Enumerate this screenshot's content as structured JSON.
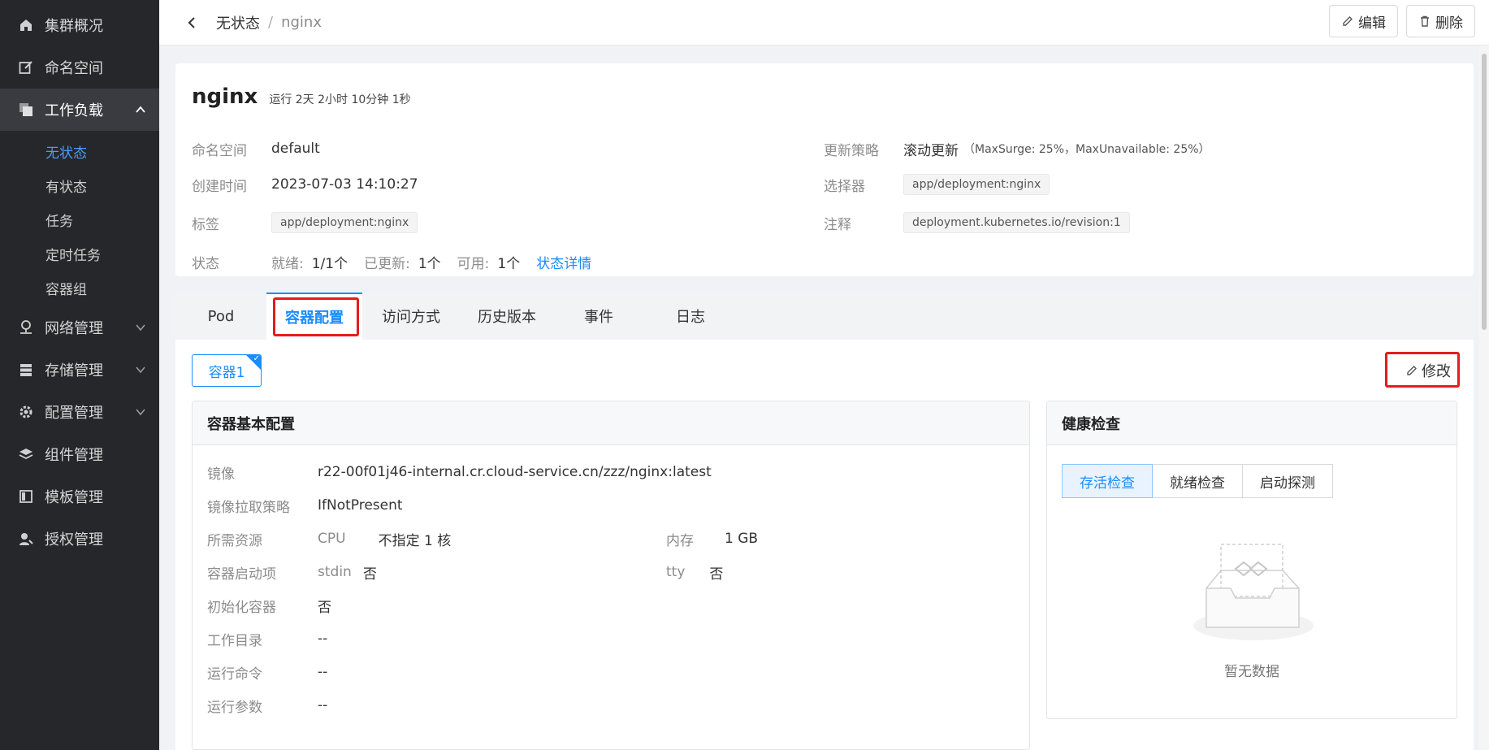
{
  "sidebar": {
    "items": [
      {
        "label": "集群概况",
        "icon": "home-icon"
      },
      {
        "label": "命名空间",
        "icon": "edit-square-icon"
      },
      {
        "label": "工作负载",
        "icon": "copy-icon",
        "expanded": true
      },
      {
        "label": "网络管理",
        "icon": "network-icon"
      },
      {
        "label": "存储管理",
        "icon": "database-icon"
      },
      {
        "label": "配置管理",
        "icon": "gear-icon"
      },
      {
        "label": "组件管理",
        "icon": "layers-icon"
      },
      {
        "label": "模板管理",
        "icon": "layout-icon"
      },
      {
        "label": "授权管理",
        "icon": "user-key-icon"
      }
    ],
    "workload_children": [
      "无状态",
      "有状态",
      "任务",
      "定时任务",
      "容器组"
    ],
    "active_child": "无状态"
  },
  "breadcrumb": {
    "parent": "无状态",
    "separator": "/",
    "current": "nginx"
  },
  "top_actions": {
    "edit": "编辑",
    "delete": "删除"
  },
  "deployment": {
    "name": "nginx",
    "runtime": "运行 2天 2小时 10分钟 1秒",
    "namespace_label": "命名空间",
    "namespace": "default",
    "created_label": "创建时间",
    "created": "2023-07-03 14:10:27",
    "labels_label": "标签",
    "labels": "app/deployment:nginx",
    "status_label": "状态",
    "status": {
      "ready_label": "就绪:",
      "ready": "1/1个",
      "updated_label": "已更新:",
      "updated": "1个",
      "available_label": "可用:",
      "available": "1个",
      "detail_link": "状态详情"
    },
    "strategy_label": "更新策略",
    "strategy": "滚动更新",
    "strategy_note": "（MaxSurge: 25%，MaxUnavailable: 25%）",
    "selector_label": "选择器",
    "selector": "app/deployment:nginx",
    "annotation_label": "注释",
    "annotation": "deployment.kubernetes.io/revision:1"
  },
  "tabs": [
    "Pod",
    "容器配置",
    "访问方式",
    "历史版本",
    "事件",
    "日志"
  ],
  "active_tab": "容器配置",
  "container_chip": "容器1",
  "modify_label": "修改",
  "basic_config": {
    "title": "容器基本配置",
    "image_label": "镜像",
    "image": "r22-00f01j46-internal.cr.cloud-service.cn/zzz/nginx:latest",
    "pull_policy_label": "镜像拉取策略",
    "pull_policy": "IfNotPresent",
    "resources_label": "所需资源",
    "cpu_label": "CPU",
    "cpu": "不指定 1 核",
    "memory_label": "内存",
    "memory": "1 GB",
    "startup_label": "容器启动项",
    "stdin_label": "stdin",
    "stdin": "否",
    "tty_label": "tty",
    "tty": "否",
    "init_label": "初始化容器",
    "init": "否",
    "workdir_label": "工作目录",
    "workdir": "--",
    "command_label": "运行命令",
    "command": "--",
    "args_label": "运行参数",
    "args": "--"
  },
  "health": {
    "title": "健康检查",
    "tabs": [
      "存活检查",
      "就绪检查",
      "启动探测"
    ],
    "active": "存活检查",
    "empty_text": "暂无数据"
  }
}
